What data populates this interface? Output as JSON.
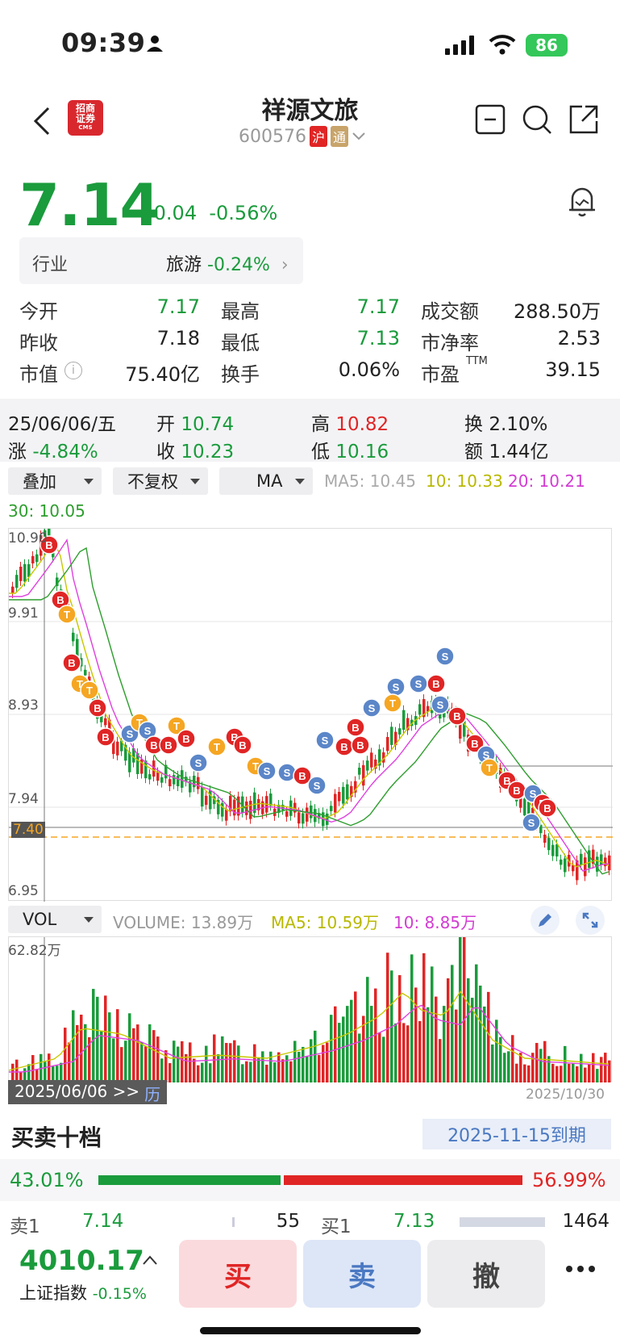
{
  "status": {
    "time": "09:39",
    "battery": "86"
  },
  "header": {
    "title": "祥源文旅",
    "code": "600576",
    "badge_hu": "沪",
    "badge_tong": "通",
    "logo_line1": "招商",
    "logo_line2": "证券",
    "logo_line3": "CMS"
  },
  "quote": {
    "price": "7.14",
    "change": "-0.04",
    "change_pct": "-0.56%",
    "industry_label": "行业",
    "industry_name": "旅游",
    "industry_pct": "-0.24%"
  },
  "stats": [
    {
      "label": "今开",
      "value": "7.17"
    },
    {
      "label": "最高",
      "value": "7.17"
    },
    {
      "label": "成交额",
      "value": "288.50万"
    },
    {
      "label": "昨收",
      "value": "7.18"
    },
    {
      "label": "最低",
      "value": "7.13"
    },
    {
      "label": "市净率",
      "value": "2.53"
    },
    {
      "label": "市值",
      "value": "75.40亿"
    },
    {
      "label": "换手",
      "value": "0.06%"
    },
    {
      "label": "市盈",
      "value": "39.15",
      "sup": "TTM"
    }
  ],
  "day": {
    "date": "25/06/06/五",
    "open_label": "开",
    "open": "10.74",
    "high_label": "高",
    "high": "10.82",
    "turn_label": "换",
    "turn": "2.10%",
    "chg_label": "涨",
    "chg": "-4.84%",
    "close_label": "收",
    "close": "10.23",
    "low_label": "低",
    "low": "10.16",
    "amt_label": "额",
    "amt": "1.44亿"
  },
  "selectors": {
    "overlay": "叠加",
    "adjust": "不复权",
    "indicator": "MA"
  },
  "ma": {
    "ma5": "MA5: 10.45",
    "ma10": "10: 10.33",
    "ma20": "20: 10.21",
    "ma30": "30: 10.05"
  },
  "chart": {
    "y_labels": [
      "10.90",
      "9.91",
      "8.93",
      "7.94",
      "6.95"
    ],
    "current_label": "7.40",
    "colors": {
      "up": "#e02525",
      "down": "#1a9b3c",
      "ma5": "#c8c800",
      "ma10": "#e040e0",
      "ma20": "#2e9e2e",
      "buy": "#e02525",
      "sell": "#5b86c8",
      "t": "#f5a623"
    }
  },
  "vol": {
    "selector": "VOL",
    "volume": "VOLUME: 13.89万",
    "ma5": "MA5: 10.59万",
    "ma10": "10: 8.85万",
    "max_label": "62.82万",
    "date_left": "2025/06/06 >>",
    "hist": "历",
    "date_right": "2025/10/30"
  },
  "orderbook": {
    "title": "买卖十档",
    "expiry": "2025-11-15到期",
    "buy_pct": "43.01%",
    "sell_pct": "56.99%",
    "buy_ratio": 0.4301,
    "ask1_label": "卖1",
    "ask1_price": "7.14",
    "ask1_qty": "55",
    "bid1_label": "买1",
    "bid1_price": "7.13",
    "bid1_qty": "1464"
  },
  "bottom": {
    "index_value": "4010.17",
    "index_name": "上证指数",
    "index_pct": "-0.15%",
    "buy": "买",
    "sell": "卖",
    "cancel": "撤"
  }
}
